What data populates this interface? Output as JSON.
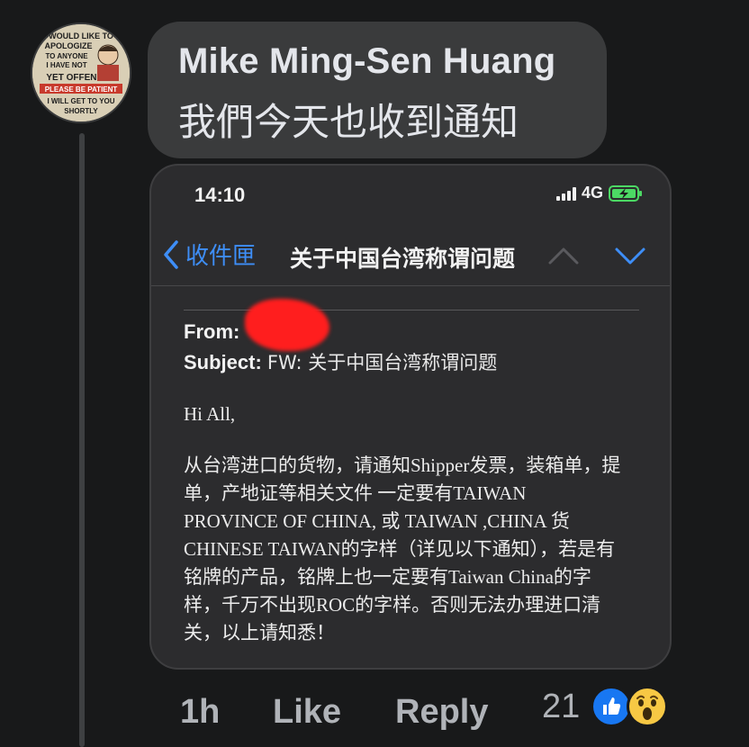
{
  "comment": {
    "author": "Mike Ming-Sen Huang",
    "text": "我們今天也收到通知",
    "avatar": {
      "lines": [
        "WOULD LIKE TO",
        "APOLOGIZE",
        "TO ANYONE",
        "I HAVE NOT",
        "YET OFFENDED",
        "PLEASE BE PATIENT",
        "I WILL GET TO YOU",
        "SHORTLY"
      ]
    }
  },
  "screenshot": {
    "status": {
      "time": "14:10",
      "network": "4G"
    },
    "nav": {
      "back_label": "收件匣",
      "title": "关于中国台湾称谓问题"
    },
    "email": {
      "from_label": "From:",
      "subject_label": "Subject:",
      "subject_value": "FW: 关于中国台湾称谓问题",
      "greeting": "Hi All,",
      "body_lines": [
        "从台湾进口的货物，请通知Shipper发票，装箱单，提",
        "单，产地证等相关文件 一定要有TAIWAN",
        "PROVINCE OF CHINA, 或 TAIWAN ,CHINA 货",
        "CHINESE TAIWAN的字样（详见以下通知），若是有",
        "铭牌的产品，铭牌上也一定要有Taiwan China的字",
        "样，千万不出现ROC的字样。否则无法办理进口清",
        "关，以上请知悉！"
      ]
    }
  },
  "actions": {
    "time": "1h",
    "like": "Like",
    "reply": "Reply",
    "reaction_count": "21"
  },
  "colors": {
    "background": "#18191a",
    "bubble": "#3a3b3c",
    "ios_blue": "#3e8ef7",
    "fb_blue": "#1877f2",
    "redaction": "#ff1e1e"
  },
  "icons": [
    "chevron-left-icon",
    "chevron-up-icon",
    "chevron-down-icon",
    "signal-icon",
    "battery-charging-icon",
    "like-reaction-icon",
    "wow-reaction-icon"
  ]
}
